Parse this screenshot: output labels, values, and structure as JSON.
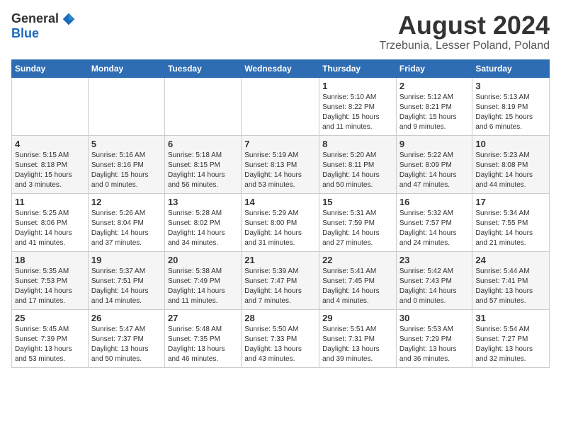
{
  "logo": {
    "general": "General",
    "blue": "Blue"
  },
  "title": "August 2024",
  "subtitle": "Trzebunia, Lesser Poland, Poland",
  "days": [
    "Sunday",
    "Monday",
    "Tuesday",
    "Wednesday",
    "Thursday",
    "Friday",
    "Saturday"
  ],
  "weeks": [
    [
      {
        "day": "",
        "info": ""
      },
      {
        "day": "",
        "info": ""
      },
      {
        "day": "",
        "info": ""
      },
      {
        "day": "",
        "info": ""
      },
      {
        "day": "1",
        "info": "Sunrise: 5:10 AM\nSunset: 8:22 PM\nDaylight: 15 hours\nand 11 minutes."
      },
      {
        "day": "2",
        "info": "Sunrise: 5:12 AM\nSunset: 8:21 PM\nDaylight: 15 hours\nand 9 minutes."
      },
      {
        "day": "3",
        "info": "Sunrise: 5:13 AM\nSunset: 8:19 PM\nDaylight: 15 hours\nand 6 minutes."
      }
    ],
    [
      {
        "day": "4",
        "info": "Sunrise: 5:15 AM\nSunset: 8:18 PM\nDaylight: 15 hours\nand 3 minutes."
      },
      {
        "day": "5",
        "info": "Sunrise: 5:16 AM\nSunset: 8:16 PM\nDaylight: 15 hours\nand 0 minutes."
      },
      {
        "day": "6",
        "info": "Sunrise: 5:18 AM\nSunset: 8:15 PM\nDaylight: 14 hours\nand 56 minutes."
      },
      {
        "day": "7",
        "info": "Sunrise: 5:19 AM\nSunset: 8:13 PM\nDaylight: 14 hours\nand 53 minutes."
      },
      {
        "day": "8",
        "info": "Sunrise: 5:20 AM\nSunset: 8:11 PM\nDaylight: 14 hours\nand 50 minutes."
      },
      {
        "day": "9",
        "info": "Sunrise: 5:22 AM\nSunset: 8:09 PM\nDaylight: 14 hours\nand 47 minutes."
      },
      {
        "day": "10",
        "info": "Sunrise: 5:23 AM\nSunset: 8:08 PM\nDaylight: 14 hours\nand 44 minutes."
      }
    ],
    [
      {
        "day": "11",
        "info": "Sunrise: 5:25 AM\nSunset: 8:06 PM\nDaylight: 14 hours\nand 41 minutes."
      },
      {
        "day": "12",
        "info": "Sunrise: 5:26 AM\nSunset: 8:04 PM\nDaylight: 14 hours\nand 37 minutes."
      },
      {
        "day": "13",
        "info": "Sunrise: 5:28 AM\nSunset: 8:02 PM\nDaylight: 14 hours\nand 34 minutes."
      },
      {
        "day": "14",
        "info": "Sunrise: 5:29 AM\nSunset: 8:00 PM\nDaylight: 14 hours\nand 31 minutes."
      },
      {
        "day": "15",
        "info": "Sunrise: 5:31 AM\nSunset: 7:59 PM\nDaylight: 14 hours\nand 27 minutes."
      },
      {
        "day": "16",
        "info": "Sunrise: 5:32 AM\nSunset: 7:57 PM\nDaylight: 14 hours\nand 24 minutes."
      },
      {
        "day": "17",
        "info": "Sunrise: 5:34 AM\nSunset: 7:55 PM\nDaylight: 14 hours\nand 21 minutes."
      }
    ],
    [
      {
        "day": "18",
        "info": "Sunrise: 5:35 AM\nSunset: 7:53 PM\nDaylight: 14 hours\nand 17 minutes."
      },
      {
        "day": "19",
        "info": "Sunrise: 5:37 AM\nSunset: 7:51 PM\nDaylight: 14 hours\nand 14 minutes."
      },
      {
        "day": "20",
        "info": "Sunrise: 5:38 AM\nSunset: 7:49 PM\nDaylight: 14 hours\nand 11 minutes."
      },
      {
        "day": "21",
        "info": "Sunrise: 5:39 AM\nSunset: 7:47 PM\nDaylight: 14 hours\nand 7 minutes."
      },
      {
        "day": "22",
        "info": "Sunrise: 5:41 AM\nSunset: 7:45 PM\nDaylight: 14 hours\nand 4 minutes."
      },
      {
        "day": "23",
        "info": "Sunrise: 5:42 AM\nSunset: 7:43 PM\nDaylight: 14 hours\nand 0 minutes."
      },
      {
        "day": "24",
        "info": "Sunrise: 5:44 AM\nSunset: 7:41 PM\nDaylight: 13 hours\nand 57 minutes."
      }
    ],
    [
      {
        "day": "25",
        "info": "Sunrise: 5:45 AM\nSunset: 7:39 PM\nDaylight: 13 hours\nand 53 minutes."
      },
      {
        "day": "26",
        "info": "Sunrise: 5:47 AM\nSunset: 7:37 PM\nDaylight: 13 hours\nand 50 minutes."
      },
      {
        "day": "27",
        "info": "Sunrise: 5:48 AM\nSunset: 7:35 PM\nDaylight: 13 hours\nand 46 minutes."
      },
      {
        "day": "28",
        "info": "Sunrise: 5:50 AM\nSunset: 7:33 PM\nDaylight: 13 hours\nand 43 minutes."
      },
      {
        "day": "29",
        "info": "Sunrise: 5:51 AM\nSunset: 7:31 PM\nDaylight: 13 hours\nand 39 minutes."
      },
      {
        "day": "30",
        "info": "Sunrise: 5:53 AM\nSunset: 7:29 PM\nDaylight: 13 hours\nand 36 minutes."
      },
      {
        "day": "31",
        "info": "Sunrise: 5:54 AM\nSunset: 7:27 PM\nDaylight: 13 hours\nand 32 minutes."
      }
    ]
  ]
}
